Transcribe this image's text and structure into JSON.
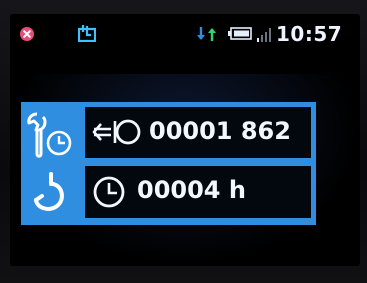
{
  "status_bar": {
    "time": "10:57",
    "icons": [
      "close-icon",
      "app-icon",
      "transfer-arrows-icon",
      "battery-icon",
      "signal-icon"
    ],
    "colors": {
      "close": "#e64e7a",
      "app": "#3fc0ff",
      "arrow_down": "#2f8ee0",
      "arrow_up": "#2fd46a",
      "text": "#eef4ff"
    }
  },
  "panel": {
    "accent_color": "#2f8ee0",
    "rows": [
      {
        "side_icon": "maintenance-timer-icon",
        "row_icon": "pulse-counter-icon",
        "value": "00001 862"
      },
      {
        "side_icon": "crane-hook-icon",
        "row_icon": "clock-icon",
        "value": "00004 h"
      }
    ]
  }
}
